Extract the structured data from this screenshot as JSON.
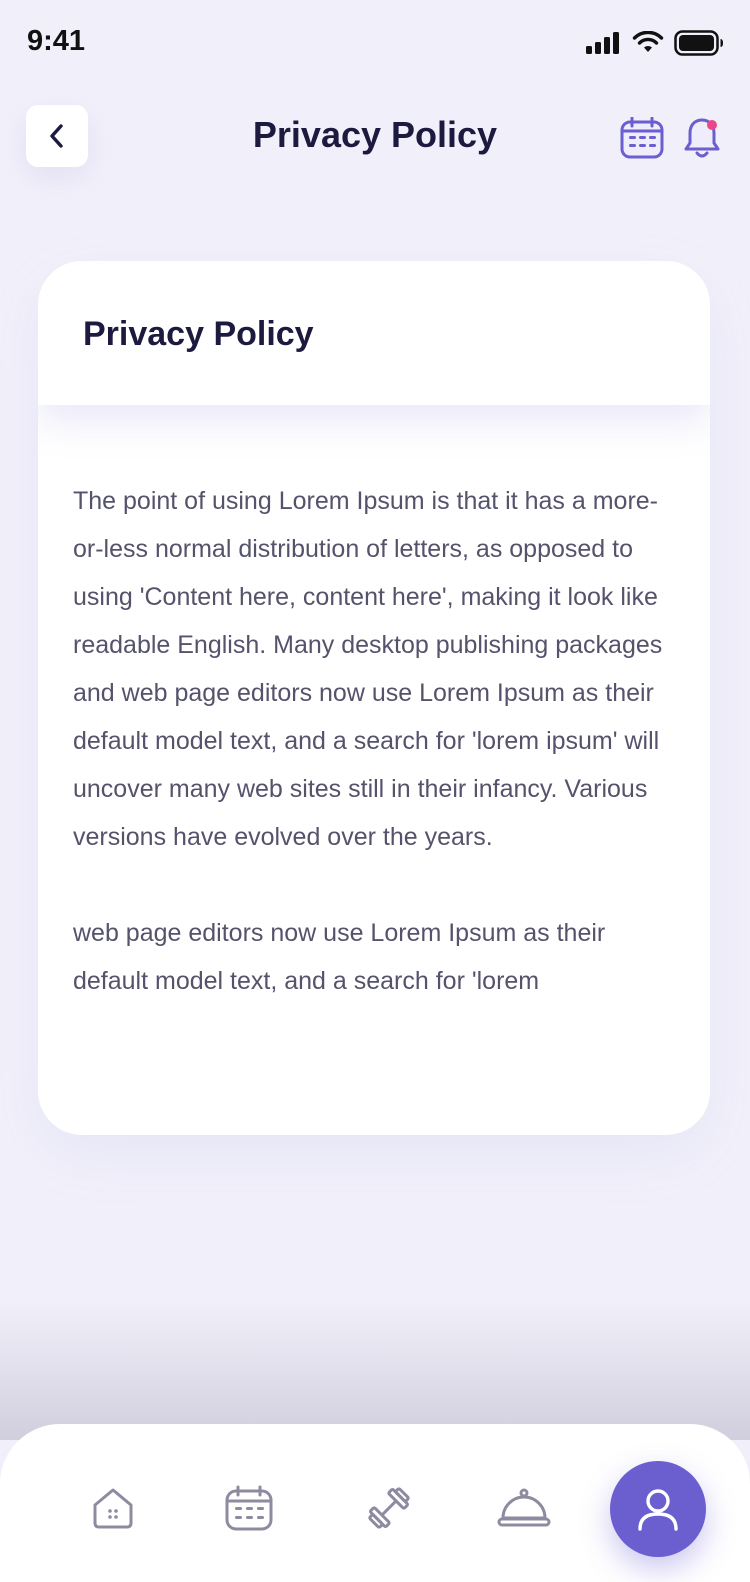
{
  "status_bar": {
    "time": "9:41",
    "icons": [
      "cellular-signal-icon",
      "wifi-icon",
      "battery-icon"
    ]
  },
  "header": {
    "title": "Privacy Policy",
    "back_icon": "chevron-left-icon",
    "right_icons": [
      "calendar-icon",
      "bell-icon"
    ]
  },
  "card": {
    "title": "Privacy Policy",
    "paragraphs": [
      "The point of using Lorem Ipsum is that it has a more-or-less normal distribution of letters, as opposed to using 'Content here, content here', making it look like readable English. Many desktop publishing packages and web page editors now use Lorem Ipsum as their default model text, and a search for 'lorem ipsum' will uncover many web sites still in their infancy. Various versions have evolved over the years.",
      "web page editors now use Lorem Ipsum as their default model text, and a search for 'lorem"
    ]
  },
  "bottom_nav": {
    "items": [
      "home-icon",
      "calendar-icon",
      "dumbbell-icon",
      "cloche-icon",
      "profile-icon"
    ],
    "active": "profile-icon"
  },
  "colors": {
    "accent": "#6b5fd0",
    "background": "#f1f0fa",
    "title_text": "#1c1a3e",
    "body_text": "#55536b",
    "notification_dot": "#e8488a",
    "inactive_icon": "#8e8ba0"
  }
}
